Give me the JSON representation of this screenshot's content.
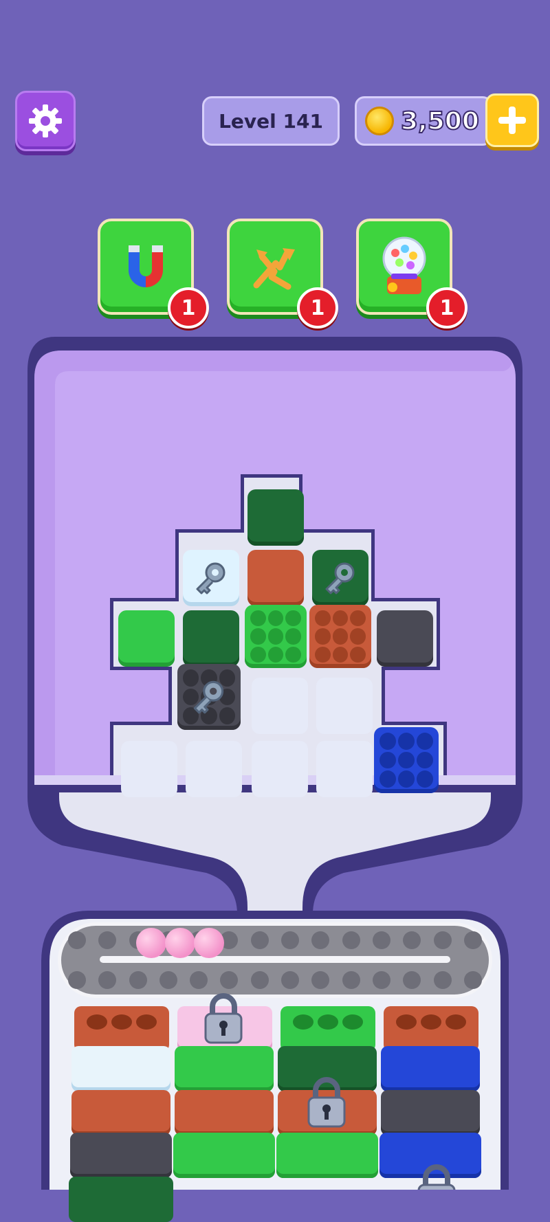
{
  "header": {
    "settings_icon": "gear-icon",
    "level_label": "Level 141",
    "coins": "3,500",
    "add_coins_icon": "plus-icon"
  },
  "boosters": [
    {
      "name": "magnet",
      "icon": "magnet-icon",
      "count": "1"
    },
    {
      "name": "shuffle",
      "icon": "shuffle-arrows-icon",
      "count": "1"
    },
    {
      "name": "gumball",
      "icon": "gumball-machine-icon",
      "count": "1"
    }
  ],
  "colors": {
    "background": "#6f62b8",
    "board": "#c6a8f4",
    "dark_green": "#1e6b36",
    "light_green": "#33c94a",
    "brown": "#c85a3a",
    "gray": "#4a4a55",
    "white": "#dff3ff",
    "blue": "#2447d8",
    "pink_ball": "#f391c9"
  },
  "board_tiles": [
    {
      "row": 0,
      "col": 2,
      "color": "dark_green"
    },
    {
      "row": 1,
      "col": 1,
      "color": "white",
      "key": true
    },
    {
      "row": 1,
      "col": 2,
      "color": "brown"
    },
    {
      "row": 1,
      "col": 3,
      "color": "dark_green",
      "key": true
    },
    {
      "row": 2,
      "col": 0,
      "color": "light_green"
    },
    {
      "row": 2,
      "col": 1,
      "color": "dark_green"
    },
    {
      "row": 2,
      "col": 2,
      "color": "light_green",
      "bumps": true
    },
    {
      "row": 2,
      "col": 3,
      "color": "brown",
      "bumps": true
    },
    {
      "row": 2,
      "col": 4,
      "color": "gray"
    },
    {
      "row": 3,
      "col": 1,
      "color": "gray",
      "key": true,
      "bumps": true
    },
    {
      "row": 4,
      "col": 4,
      "color": "blue",
      "bumps": true
    }
  ],
  "conveyor": {
    "balls": 3
  },
  "columns": [
    {
      "blocks": [
        "brown",
        "white",
        "brown",
        "gray",
        "dark_green"
      ],
      "locked_index": null
    },
    {
      "blocks": [
        "pink_lock",
        "light_green",
        "brown",
        "light_green"
      ],
      "locked_index": 0
    },
    {
      "blocks": [
        "light_green",
        "dark_green",
        "brown",
        "light_green"
      ],
      "locked_index": 2
    },
    {
      "blocks": [
        "brown",
        "blue",
        "gray",
        "blue"
      ],
      "locked_index": 4
    }
  ]
}
